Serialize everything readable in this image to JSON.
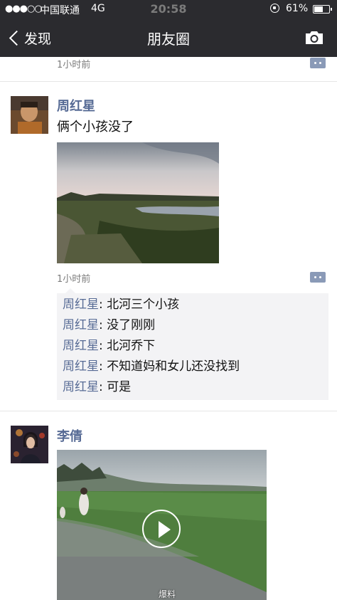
{
  "status_bar": {
    "signal": "●●●○○",
    "carrier": "中国联通",
    "network": "4G",
    "time": "20:58",
    "battery_text": "61%",
    "battery_level": 0.61
  },
  "nav": {
    "back_label": "发现",
    "title": "朋友圈",
    "camera_icon": "camera-icon",
    "back_icon": "chevron-left-icon"
  },
  "feed": {
    "previous_post_time": "1小时前",
    "posts": [
      {
        "author": "周红星",
        "text": "俩个小孩没了",
        "time": "1小时前",
        "comments": [
          {
            "name": "周红星",
            "sep": ": ",
            "text": "北河三个小孩"
          },
          {
            "name": "周红星",
            "sep": ": ",
            "text": "没了刚刚"
          },
          {
            "name": "周红星",
            "sep": ": ",
            "text": "北河乔下"
          },
          {
            "name": "周红星",
            "sep": ": ",
            "text": "不知道妈和女儿还没找到"
          },
          {
            "name": "周红星",
            "sep": ": ",
            "text": "可是"
          }
        ]
      },
      {
        "author": "李倩",
        "video_watermark": "爆料"
      }
    ]
  },
  "colors": {
    "nav_bg": "#2b2b2f",
    "name_link": "#576b95",
    "comment_bg": "#f3f3f5",
    "meta_text": "#7b7b7b"
  }
}
